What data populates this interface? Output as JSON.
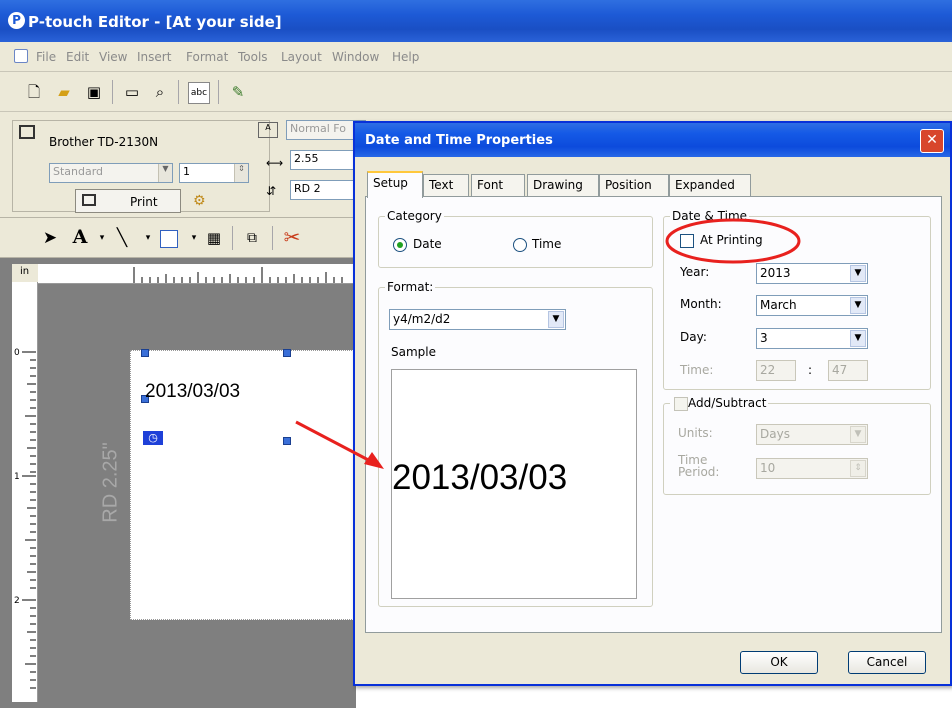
{
  "window": {
    "title": "P-touch Editor - [At your side]"
  },
  "menu": [
    "File",
    "Edit",
    "View",
    "Insert",
    "Format",
    "Tools",
    "Layout",
    "Window",
    "Help"
  ],
  "printer_panel": {
    "printer_name": "Brother TD-2130N",
    "mode": "Standard",
    "copies": "1",
    "print_label": "Print"
  },
  "format_panel": {
    "font_field": "Normal Fo",
    "length_field": "2.55",
    "media_field": "RD 2"
  },
  "ruler": {
    "unit": "in",
    "v_marks": [
      "0",
      "1",
      "2"
    ]
  },
  "label": {
    "date_text": "2013/03/03",
    "media_text": "RD 2.25\""
  },
  "dialog": {
    "title": "Date and Time Properties",
    "tabs": [
      "Setup",
      "Text",
      "Font",
      "Drawing",
      "Position",
      "Expanded"
    ],
    "category": {
      "label": "Category",
      "options": [
        {
          "label": "Date",
          "selected": true
        },
        {
          "label": "Time",
          "selected": false
        }
      ]
    },
    "format": {
      "label": "Format:",
      "value": "y4/m2/d2"
    },
    "sample": {
      "label": "Sample",
      "value": "2013/03/03"
    },
    "datetime": {
      "label": "Date & Time",
      "at_printing": {
        "label": "At Printing",
        "checked": false
      },
      "year": {
        "label": "Year:",
        "value": "2013"
      },
      "month": {
        "label": "Month:",
        "value": "March"
      },
      "day": {
        "label": "Day:",
        "value": "3"
      },
      "time": {
        "label": "Time:",
        "hour": "22",
        "sep": ":",
        "minute": "47"
      }
    },
    "addsub": {
      "label": "Add/Subtract",
      "units": {
        "label": "Units:",
        "value": "Days"
      },
      "period": {
        "label": "Time Period:",
        "value": "10"
      }
    },
    "buttons": {
      "ok": "OK",
      "cancel": "Cancel"
    }
  },
  "colors": {
    "titlebar": "#1d5ad6",
    "annotation": "#e8211e",
    "face": "#ece9d8"
  }
}
